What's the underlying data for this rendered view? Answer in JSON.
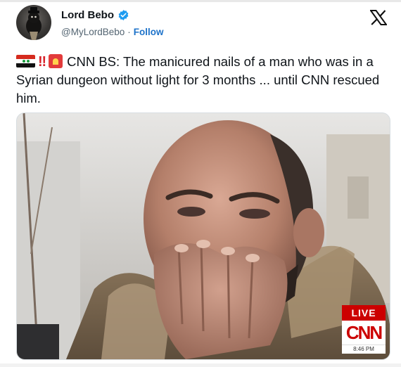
{
  "author": {
    "name": "Lord Bebo",
    "handle": "@MyLordBebo",
    "separator": "·",
    "follow_label": "Follow",
    "verified_icon": "verified-badge-icon",
    "verified_color": "#1d9bf0"
  },
  "platform_icon": "x-logo-icon",
  "tweet": {
    "emojis": [
      "syria-flag-emoji",
      "double-exclamation-emoji",
      "siren-emoji"
    ],
    "text": "CNN BS: The manicured nails of a man who was in a Syrian dungeon without light for 3 months ... until CNN rescued him."
  },
  "media": {
    "description_icon": "news-video-frame",
    "overlay": {
      "live_label": "LIVE",
      "network_label": "CNN",
      "time_label": "8:46 PM",
      "live_color": "#cc0000"
    }
  }
}
